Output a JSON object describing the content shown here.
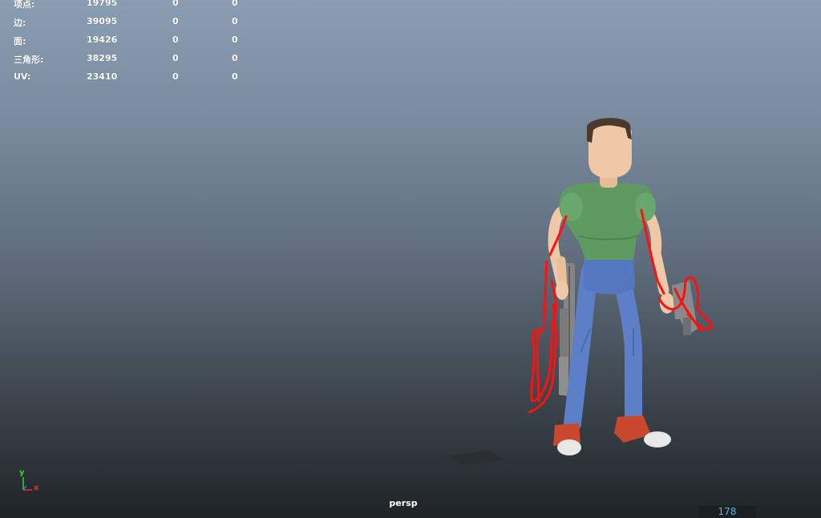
{
  "hud": {
    "rows": [
      {
        "label": "项点:",
        "value": "19795",
        "v2": "0",
        "v3": "0"
      },
      {
        "label": "边:",
        "value": "39095",
        "v2": "0",
        "v3": "0"
      },
      {
        "label": "面:",
        "value": "19426",
        "v2": "0",
        "v3": "0"
      },
      {
        "label": "三角形:",
        "value": "38295",
        "v2": "0",
        "v3": "0"
      },
      {
        "label": "UV:",
        "value": "23410",
        "v2": "0",
        "v3": "0"
      }
    ]
  },
  "viewport": {
    "camera": "persp",
    "frame": "178"
  },
  "axis": {
    "y": "y",
    "x": "x"
  },
  "colors": {
    "shirt": "#5e9a62",
    "pants": "#5c7fc8",
    "skin": "#efc9a7",
    "hair": "#4a3a2c",
    "shoes": "#c9482e",
    "gun": "#8c8c8c",
    "annotation": "#ff1010",
    "frame_text": "#58b7d9"
  }
}
